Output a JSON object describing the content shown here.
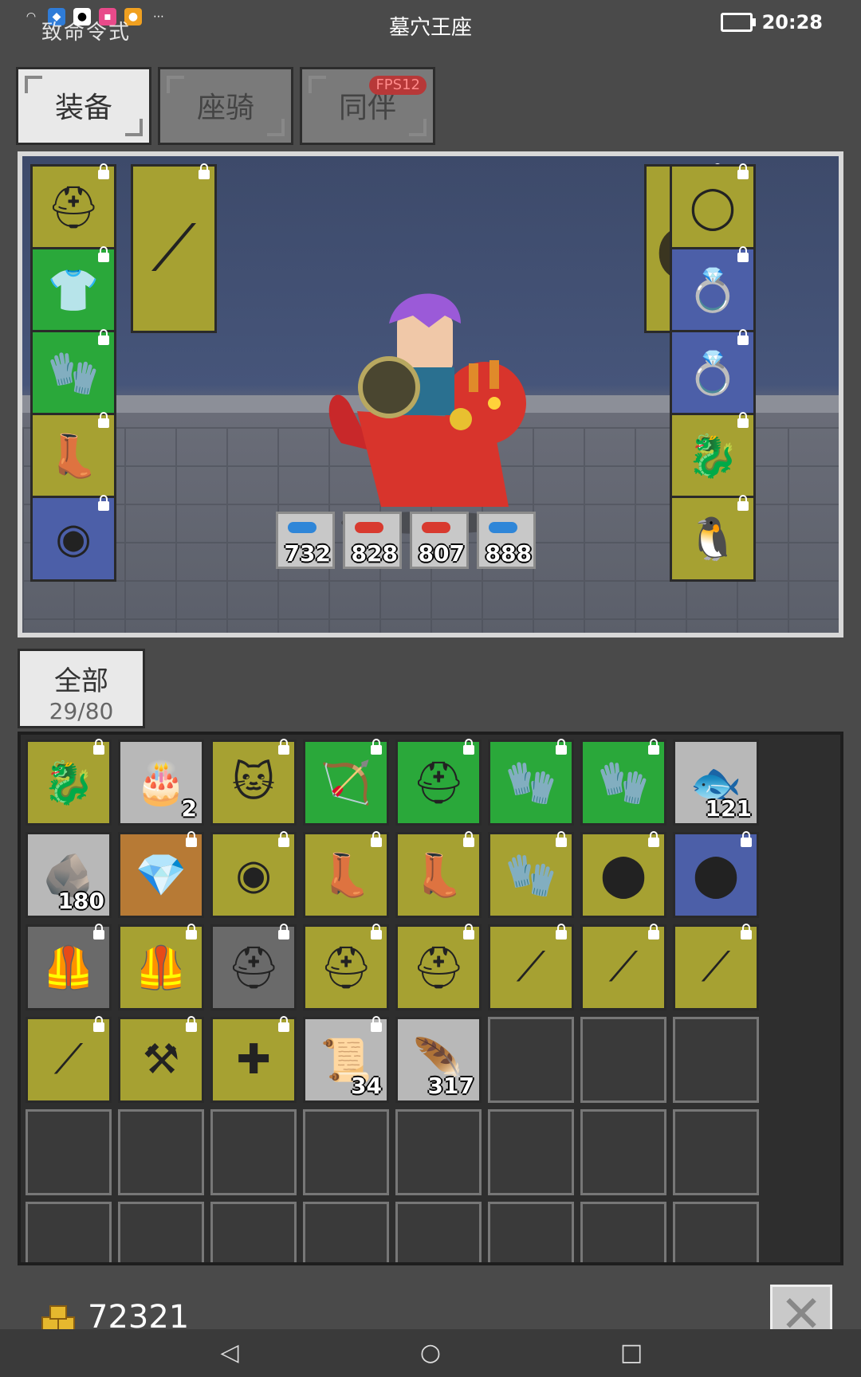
{
  "status_bar": {
    "left_text": "致命令式",
    "title": "墓穴王座",
    "time": "20:28"
  },
  "tabs": [
    {
      "label": "装备",
      "active": true
    },
    {
      "label": "座骑",
      "active": false
    },
    {
      "label": "同伴",
      "active": false,
      "badge": "FPS12"
    }
  ],
  "equipment": {
    "left_column": [
      {
        "name": "helmet-icon",
        "rarity": "gold",
        "glyph": "⛑"
      },
      {
        "name": "armor-icon",
        "rarity": "green",
        "glyph": "👕"
      },
      {
        "name": "gauntlet-icon",
        "rarity": "green",
        "glyph": "🧤"
      },
      {
        "name": "boots-icon",
        "rarity": "gold",
        "glyph": "👢"
      },
      {
        "name": "belt-icon",
        "rarity": "blue",
        "glyph": "◉"
      }
    ],
    "weapon": {
      "name": "spear-icon",
      "rarity": "gold",
      "glyph": "⟋"
    },
    "offhand": {
      "name": "shield-icon",
      "rarity": "gold",
      "glyph": "⬤"
    },
    "right_column": [
      {
        "name": "necklace-icon",
        "rarity": "gold",
        "glyph": "◯"
      },
      {
        "name": "ring-icon",
        "rarity": "blue",
        "glyph": "💍"
      },
      {
        "name": "ring-icon",
        "rarity": "blue",
        "glyph": "💍"
      },
      {
        "name": "dragon-mount-icon",
        "rarity": "gold",
        "glyph": "🐉"
      },
      {
        "name": "penguin-pet-icon",
        "rarity": "gold",
        "glyph": "🐧"
      }
    ],
    "stats": [
      {
        "value": "732",
        "color": "#2f86d8"
      },
      {
        "value": "828",
        "color": "#d83a2f"
      },
      {
        "value": "807",
        "color": "#d83a2f"
      },
      {
        "value": "888",
        "color": "#2f86d8"
      }
    ]
  },
  "bag": {
    "label": "全部",
    "count": "29/80"
  },
  "inventory": [
    {
      "name": "dragon-mount-icon",
      "rarity": "gold",
      "glyph": "🐉",
      "locked": true
    },
    {
      "name": "cake-icon",
      "rarity": "gray",
      "glyph": "🎂",
      "qty": "2"
    },
    {
      "name": "cat-pet-icon",
      "rarity": "gold",
      "glyph": "🐱",
      "locked": true
    },
    {
      "name": "bow-icon",
      "rarity": "green",
      "glyph": "🏹",
      "locked": true
    },
    {
      "name": "helmet-icon",
      "rarity": "green",
      "glyph": "⛑",
      "locked": true
    },
    {
      "name": "glove-icon",
      "rarity": "green",
      "glyph": "🧤",
      "locked": true
    },
    {
      "name": "glove-icon",
      "rarity": "green",
      "glyph": "🧤",
      "locked": true
    },
    {
      "name": "fish-icon",
      "rarity": "gray",
      "glyph": "🐟",
      "qty": "121"
    },
    {
      "name": "ore-icon",
      "rarity": "gray",
      "glyph": "🪨",
      "qty": "180"
    },
    {
      "name": "emerald-icon",
      "rarity": "orange",
      "glyph": "💎",
      "locked": true
    },
    {
      "name": "belt-icon",
      "rarity": "gold",
      "glyph": "◉",
      "locked": true
    },
    {
      "name": "boots-icon",
      "rarity": "gold",
      "glyph": "👢",
      "locked": true
    },
    {
      "name": "boots-icon",
      "rarity": "gold",
      "glyph": "👢",
      "locked": true
    },
    {
      "name": "chain-glove-icon",
      "rarity": "gold",
      "glyph": "🧤",
      "locked": true
    },
    {
      "name": "shield-icon",
      "rarity": "gold",
      "glyph": "⬤",
      "locked": true
    },
    {
      "name": "shield-icon",
      "rarity": "blue",
      "glyph": "⬤",
      "locked": true
    },
    {
      "name": "armor-icon",
      "rarity": "darkgray",
      "glyph": "🦺",
      "locked": true
    },
    {
      "name": "leather-armor-icon",
      "rarity": "gold",
      "glyph": "🦺",
      "locked": true
    },
    {
      "name": "horned-helmet-icon",
      "rarity": "darkgray",
      "glyph": "⛑",
      "locked": true
    },
    {
      "name": "helmet-icon",
      "rarity": "gold",
      "glyph": "⛑",
      "locked": true
    },
    {
      "name": "helmet-icon",
      "rarity": "gold",
      "glyph": "⛑",
      "locked": true
    },
    {
      "name": "spear-icon",
      "rarity": "gold",
      "glyph": "⟋",
      "locked": true
    },
    {
      "name": "spear-icon",
      "rarity": "gold",
      "glyph": "⟋",
      "locked": true
    },
    {
      "name": "spear-icon",
      "rarity": "gold",
      "glyph": "⟋",
      "locked": true
    },
    {
      "name": "spear-icon",
      "rarity": "gold",
      "glyph": "⟋",
      "locked": true
    },
    {
      "name": "axe-icon",
      "rarity": "gold",
      "glyph": "⚒",
      "locked": true
    },
    {
      "name": "crossbow-icon",
      "rarity": "gold",
      "glyph": "✚",
      "locked": true
    },
    {
      "name": "scroll-icon",
      "rarity": "gray",
      "glyph": "📜",
      "qty": "34",
      "locked": true
    },
    {
      "name": "feather-icon",
      "rarity": "gray",
      "glyph": "🪶",
      "qty": "317"
    }
  ],
  "gold": "72321"
}
